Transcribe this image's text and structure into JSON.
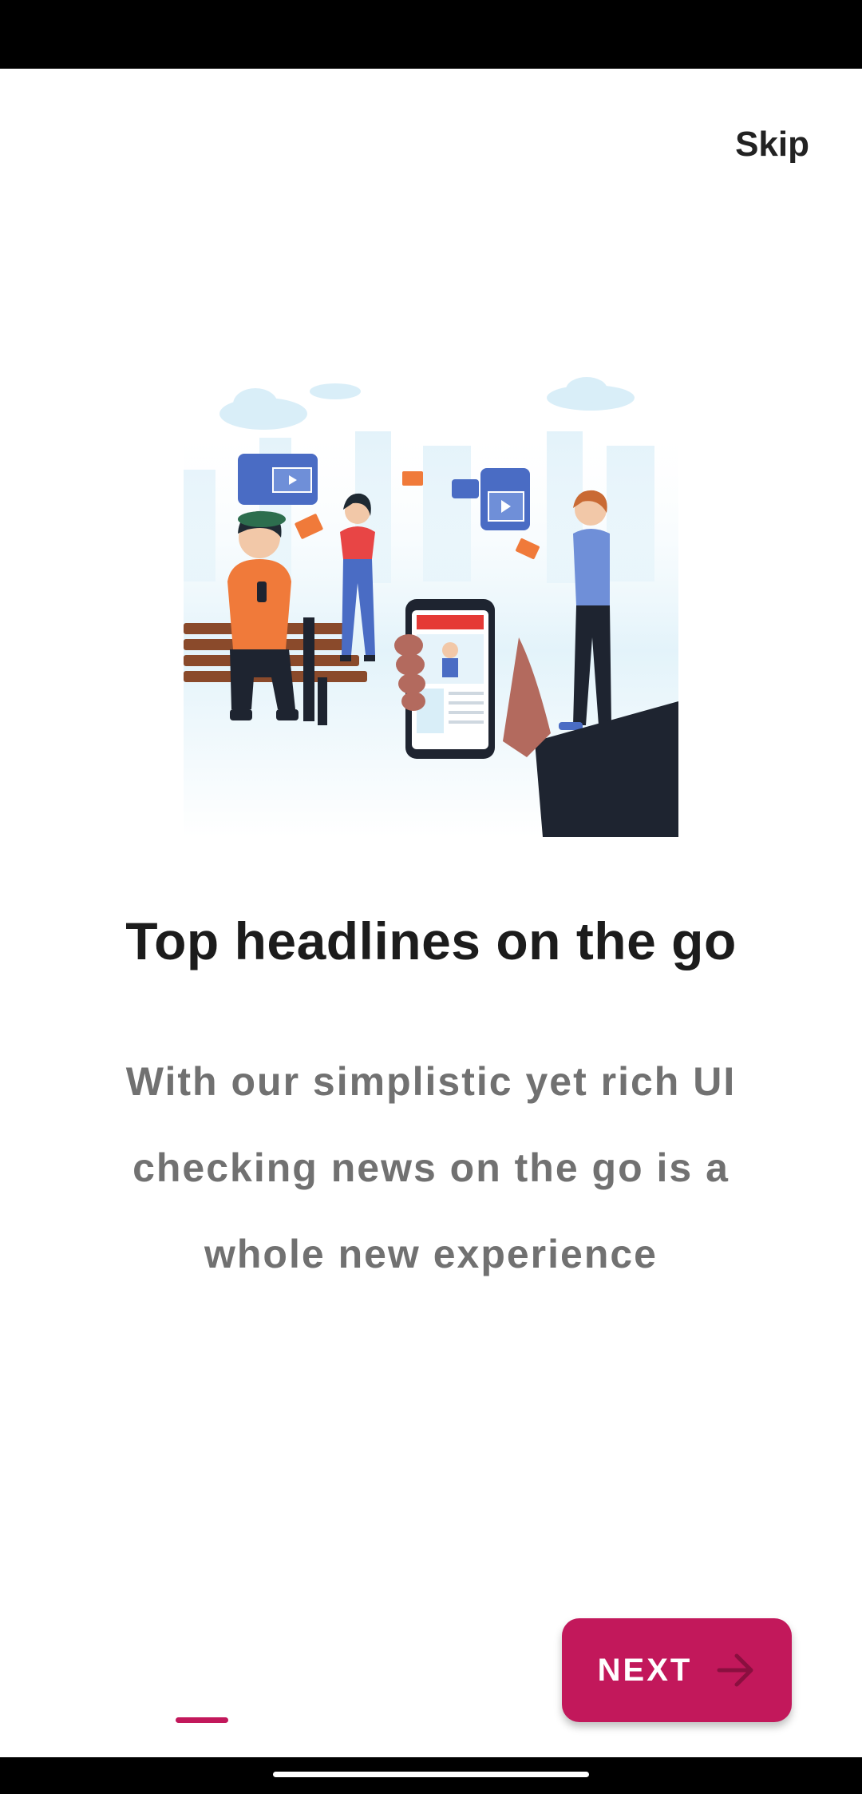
{
  "header": {
    "skip_label": "Skip"
  },
  "onboarding": {
    "headline": "Top headlines on the go",
    "description": "With our simplistic yet rich UI checking news on the go is a whole new experience"
  },
  "pager": {
    "current_page": 1
  },
  "footer": {
    "next_label": "NEXT",
    "next_icon": "arrow-right-icon"
  },
  "colors": {
    "accent": "#C2185B",
    "headline": "#1C1C1C",
    "description": "#717171",
    "status_bar": "#000000"
  }
}
